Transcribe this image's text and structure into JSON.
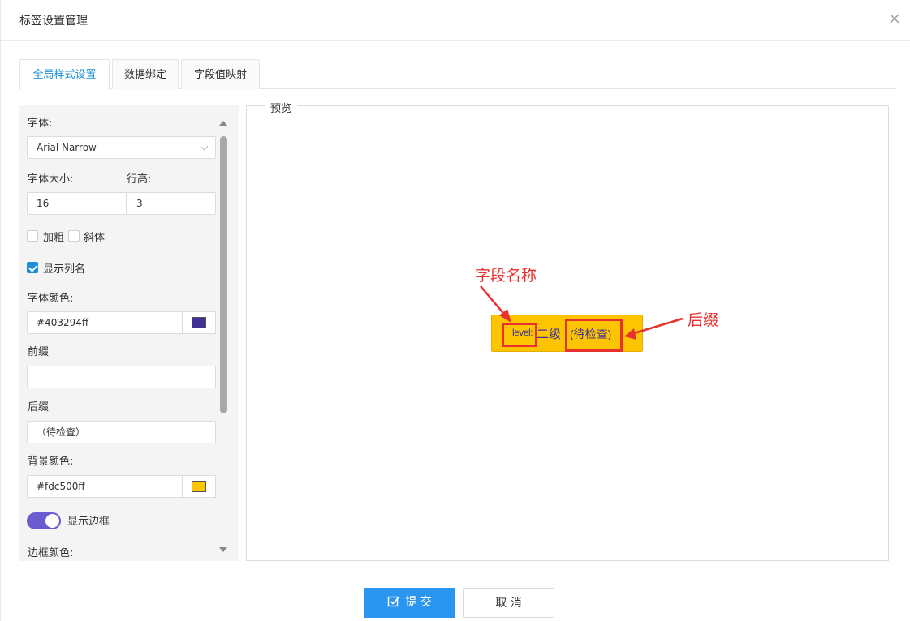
{
  "dialog": {
    "title": "标签设置管理"
  },
  "tabs": [
    {
      "label": "全局样式设置",
      "active": true
    },
    {
      "label": "数据绑定",
      "active": false
    },
    {
      "label": "字段值映射",
      "active": false
    }
  ],
  "form": {
    "font_label": "字体:",
    "font_value": "Arial Narrow",
    "font_size_label": "字体大小:",
    "font_size_value": "16",
    "line_height_label": "行高:",
    "line_height_value": "3",
    "bold_label": "加粗",
    "bold_checked": false,
    "italic_label": "斜体",
    "italic_checked": false,
    "show_column_label": "显示列名",
    "show_column_checked": true,
    "font_color_label": "字体颜色:",
    "font_color_value": "#403294ff",
    "font_color_swatch": "#403294",
    "prefix_label": "前缀",
    "prefix_value": "",
    "suffix_label": "后缀",
    "suffix_value": "（待检查）",
    "bg_color_label": "背景颜色:",
    "bg_color_value": "#fdc500ff",
    "bg_color_swatch": "#fdc500",
    "show_border_label": "显示边框",
    "show_border_on": true,
    "border_color_label": "边框颜色:"
  },
  "preview": {
    "legend": "预览",
    "tag_field": "level:",
    "tag_value": "二级",
    "tag_suffix": "(待检查)",
    "annotation_field": "字段名称",
    "annotation_suffix": "后缀"
  },
  "footer": {
    "submit_label": "提 交",
    "cancel_label": "取 消"
  },
  "colors": {
    "accent": "#1e90d8",
    "primary_button": "#2b96f0",
    "annotation": "#e8312f",
    "toggle": "#6b5bd0"
  }
}
